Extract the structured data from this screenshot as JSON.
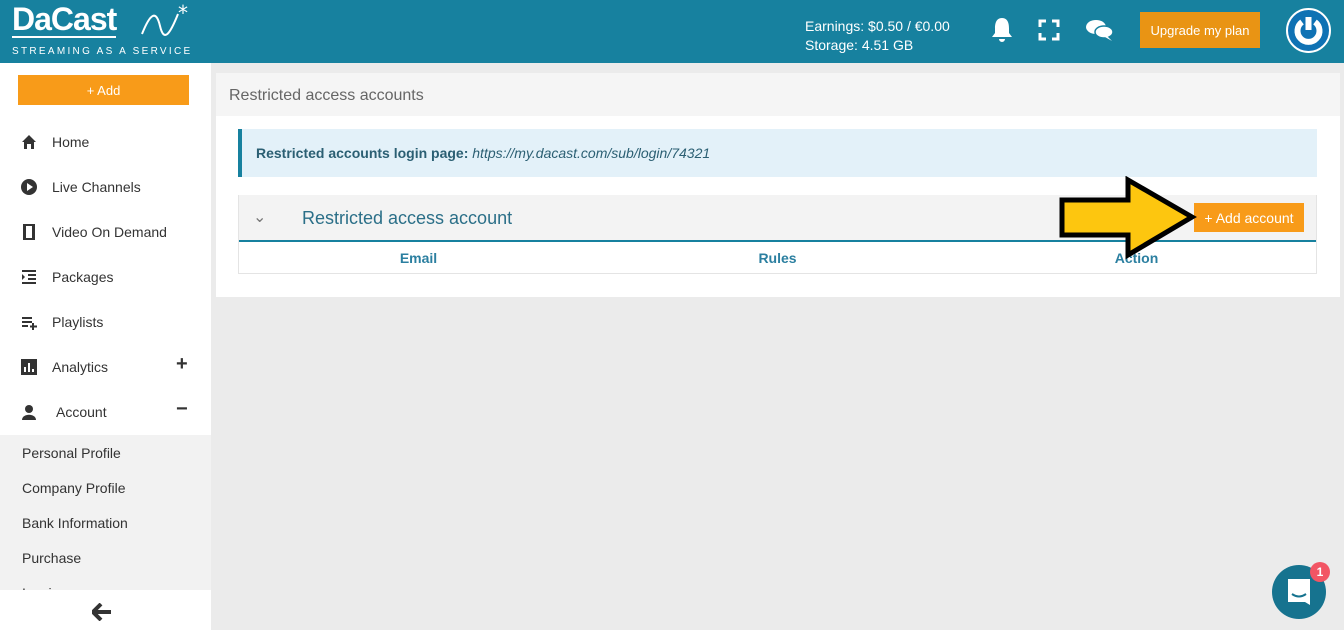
{
  "header": {
    "logo_name": "DaCast",
    "logo_tagline": "STREAMING AS A SERVICE",
    "earnings": "Earnings: $0.50 / €0.00",
    "storage": "Storage: 4.51 GB",
    "upgrade_label": "Upgrade my plan",
    "brand_color": "#17819f",
    "accent_color": "#f89b19"
  },
  "sidebar": {
    "add_label": "+ Add",
    "items": [
      {
        "label": "Home",
        "icon": "home-icon"
      },
      {
        "label": "Live Channels",
        "icon": "play-circle-icon"
      },
      {
        "label": "Video On Demand",
        "icon": "film-icon"
      },
      {
        "label": "Packages",
        "icon": "indent-list-icon"
      },
      {
        "label": "Playlists",
        "icon": "playlist-add-icon"
      },
      {
        "label": "Analytics",
        "icon": "bar-chart-icon",
        "toggle": "+"
      },
      {
        "label": "Account",
        "icon": "user-icon",
        "toggle": "−"
      }
    ],
    "account_sub": [
      "Personal Profile",
      "Company Profile",
      "Bank Information",
      "Purchase",
      "Invoices"
    ]
  },
  "main": {
    "title": "Restricted access accounts",
    "info_label": "Restricted accounts login page:",
    "info_url": "https://my.dacast.com/sub/login/74321",
    "panel_title": "Restricted access account",
    "add_account_label": "+ Add account",
    "columns": [
      "Email",
      "Rules",
      "Action"
    ]
  },
  "chat": {
    "badge": "1"
  }
}
